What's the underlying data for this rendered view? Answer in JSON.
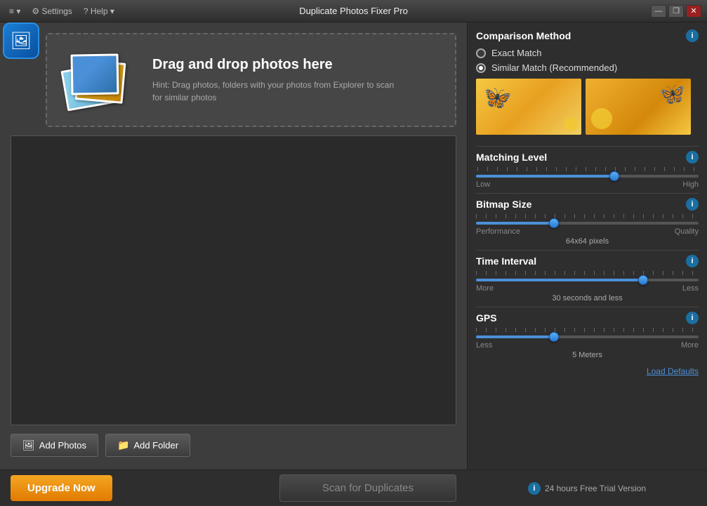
{
  "titleBar": {
    "title": "Duplicate Photos Fixer Pro",
    "menu": {
      "settings": "⚙ Settings",
      "help": "? Help ▾",
      "list_icon": "≡ ▾"
    },
    "controls": {
      "minimize": "—",
      "restore": "❐",
      "close": "✕"
    }
  },
  "dropZone": {
    "heading": "Drag and drop photos here",
    "hint": "Hint: Drag photos, folders with your photos from Explorer to scan for similar photos"
  },
  "buttons": {
    "addPhotos": "Add Photos",
    "addFolder": "Add Folder",
    "upgrade": "Upgrade Now",
    "scan": "Scan for Duplicates"
  },
  "trialNotice": "24 hours Free Trial Version",
  "rightPanel": {
    "comparisonMethod": {
      "title": "Comparison Method",
      "options": [
        {
          "label": "Exact Match",
          "selected": false
        },
        {
          "label": "Similar Match (Recommended)",
          "selected": true
        }
      ]
    },
    "matchingLevel": {
      "title": "Matching Level",
      "lowLabel": "Low",
      "highLabel": "High",
      "thumbPosition": 62
    },
    "bitmapSize": {
      "title": "Bitmap Size",
      "performanceLabel": "Performance",
      "qualityLabel": "Quality",
      "valueLabel": "64x64 pixels",
      "thumbPosition": 35
    },
    "timeInterval": {
      "title": "Time Interval",
      "moreLabel": "More",
      "lessLabel": "Less",
      "valueLabel": "30 seconds and less",
      "thumbPosition": 75
    },
    "gps": {
      "title": "GPS",
      "lessLabel": "Less",
      "moreLabel": "More",
      "valueLabel": "5 Meters",
      "thumbPosition": 35
    },
    "loadDefaults": "Load Defaults"
  }
}
